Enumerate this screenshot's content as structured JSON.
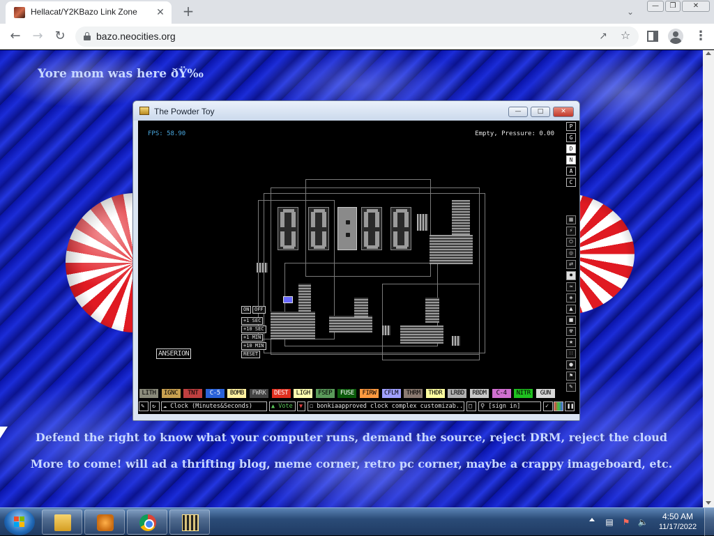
{
  "browser": {
    "tab_title": "Hellacat/Y2KBazo Link Zone",
    "tab_close_glyph": "✕",
    "new_tab_glyph": "+",
    "url": "bazo.neocities.org",
    "back_glyph": "←",
    "forward_glyph": "→",
    "reload_glyph": "↻",
    "icons": [
      "lock-icon",
      "share-icon",
      "star-icon",
      "side-panel-icon",
      "profile-icon",
      "menu-icon"
    ]
  },
  "page": {
    "top_text": "Yore mom was here ðŸ‰",
    "footer_line_1": "Defend the right to know what your computer runs, demand the source, reject DRM, reject the cloud",
    "footer_line_2": "More to come! will ad a thrifting blog, meme corner, retro pc corner, maybe a crappy imageboard, etc.",
    "background_accent": "#0a18b8"
  },
  "powder_toy": {
    "window_title": "The Powder Toy",
    "fps": "FPS: 58.90",
    "status": "Empty, Pressure: 0.00",
    "author_tag": "ANSERION",
    "clock_digits": [
      "0",
      "0",
      "0",
      "0"
    ],
    "controls": [
      "ON",
      "OFF",
      "+1 SEC",
      "+10 SEC",
      "+1 MIN",
      "+10 MIN",
      "RESET"
    ],
    "sidebar_modes": [
      "P",
      "G",
      "D",
      "N",
      "A",
      "C"
    ],
    "elements": [
      {
        "label": "LITH",
        "bg": "#8a8a7a",
        "fg": "#000"
      },
      {
        "label": "IGNC",
        "bg": "#c8a050",
        "fg": "#000"
      },
      {
        "label": "TNT",
        "bg": "#c04040",
        "fg": "#000"
      },
      {
        "label": "C-5",
        "bg": "#2a62d8",
        "fg": "#fff"
      },
      {
        "label": "BOMB",
        "bg": "#fff0a0",
        "fg": "#000"
      },
      {
        "label": "FWRK",
        "bg": "#444444",
        "fg": "#ccc"
      },
      {
        "label": "DEST",
        "bg": "#e03020",
        "fg": "#fff"
      },
      {
        "label": "LIGH",
        "bg": "#ffffb0",
        "fg": "#000"
      },
      {
        "label": "FSEP",
        "bg": "#5a9a5a",
        "fg": "#000"
      },
      {
        "label": "FUSE",
        "bg": "#0a5a0a",
        "fg": "#fff"
      },
      {
        "label": "FIRW",
        "bg": "#ff9a40",
        "fg": "#000"
      },
      {
        "label": "CFLM",
        "bg": "#a0a0ff",
        "fg": "#000"
      },
      {
        "label": "THRM",
        "bg": "#8a7a70",
        "fg": "#000"
      },
      {
        "label": "THDR",
        "bg": "#ffffa0",
        "fg": "#000"
      },
      {
        "label": "LRBD",
        "bg": "#b0b0b0",
        "fg": "#000"
      },
      {
        "label": "RBDM",
        "bg": "#c8c8c8",
        "fg": "#000"
      },
      {
        "label": "C-4",
        "bg": "#d070d0",
        "fg": "#000"
      },
      {
        "label": "NITR",
        "bg": "#20c020",
        "fg": "#000"
      },
      {
        "label": "GUN",
        "bg": "#d8d8d8",
        "fg": "#000"
      }
    ],
    "save_name": "Clock (Minutes&Seconds)",
    "vote_label": "Vote",
    "description": "bonkiaapproved clock complex customizab...",
    "sign_in": "[sign in]"
  },
  "taskbar": {
    "clock_time": "4:50 AM",
    "clock_date": "11/17/2022",
    "apps": [
      "Windows Explorer",
      "Windows Media Player",
      "Google Chrome",
      "The Powder Toy"
    ]
  }
}
